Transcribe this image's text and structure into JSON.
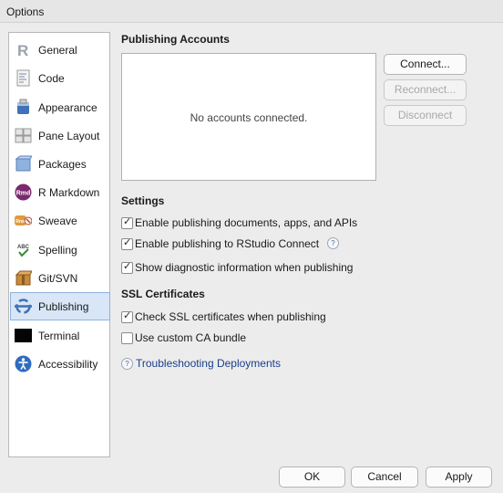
{
  "window": {
    "title": "Options"
  },
  "sidebar": {
    "items": [
      {
        "label": "General",
        "icon": "r-logo-icon"
      },
      {
        "label": "Code",
        "icon": "code-document-icon"
      },
      {
        "label": "Appearance",
        "icon": "paint-bucket-icon"
      },
      {
        "label": "Pane Layout",
        "icon": "pane-layout-icon"
      },
      {
        "label": "Packages",
        "icon": "package-box-icon"
      },
      {
        "label": "R Markdown",
        "icon": "rmd-icon",
        "icon_text": "Rmd"
      },
      {
        "label": "Sweave",
        "icon": "sweave-icon",
        "icon_text": "Rnw"
      },
      {
        "label": "Spelling",
        "icon": "spelling-check-icon",
        "icon_text": "ABC"
      },
      {
        "label": "Git/SVN",
        "icon": "git-box-icon"
      },
      {
        "label": "Publishing",
        "icon": "publishing-icon",
        "selected": true
      },
      {
        "label": "Terminal",
        "icon": "terminal-icon"
      },
      {
        "label": "Accessibility",
        "icon": "accessibility-icon"
      }
    ]
  },
  "publishing_accounts": {
    "title": "Publishing Accounts",
    "empty_text": "No accounts connected.",
    "connect_label": "Connect...",
    "reconnect_label": "Reconnect...",
    "disconnect_label": "Disconnect"
  },
  "settings": {
    "title": "Settings",
    "options": [
      {
        "label": "Enable publishing documents, apps, and APIs",
        "checked": true
      },
      {
        "label": "Enable publishing to RStudio Connect",
        "checked": true,
        "help": true
      },
      {
        "label": "Show diagnostic information when publishing",
        "checked": true
      }
    ]
  },
  "ssl": {
    "title": "SSL Certificates",
    "options": [
      {
        "label": "Check SSL certificates when publishing",
        "checked": true
      },
      {
        "label": "Use custom CA bundle",
        "checked": false
      }
    ]
  },
  "troubleshooting": {
    "label": "Troubleshooting Deployments"
  },
  "footer": {
    "ok_label": "OK",
    "cancel_label": "Cancel",
    "apply_label": "Apply"
  },
  "colors": {
    "selection": "#d8e6f7",
    "link": "#1a3e8a",
    "rstudio_blue": "#3f72b8"
  }
}
